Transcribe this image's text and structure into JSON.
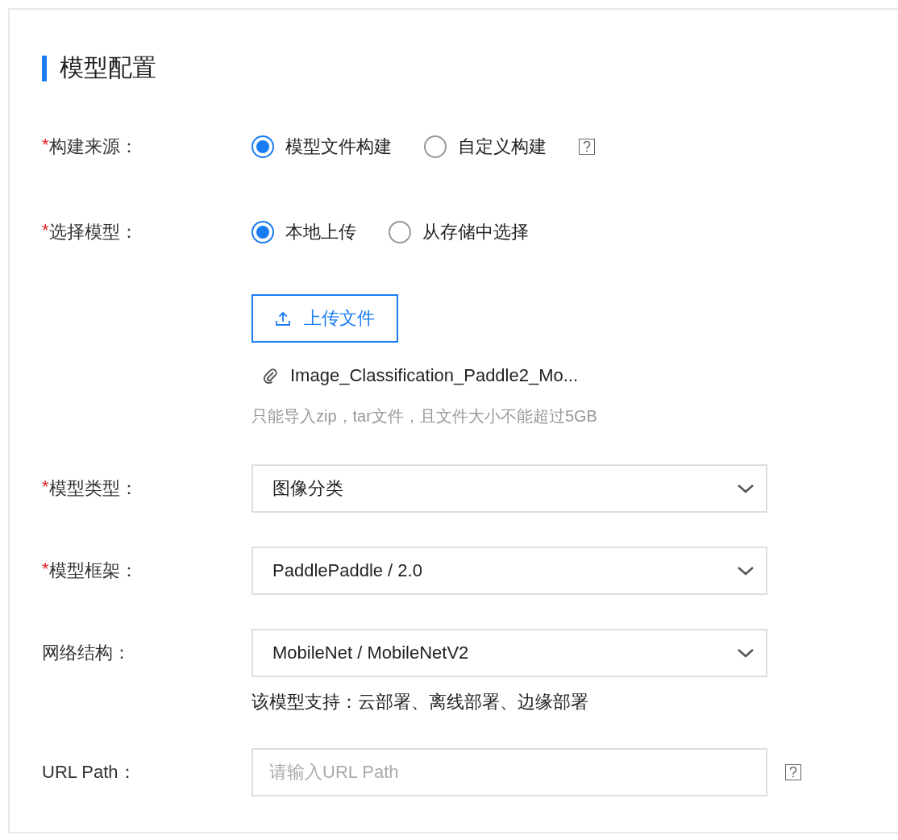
{
  "section": {
    "title": "模型配置"
  },
  "fields": [
    {
      "kind": "radio",
      "mark": "*",
      "label": "构建来源：",
      "help": true,
      "options": [
        {
          "label": "模型文件构建",
          "selected": true
        },
        {
          "label": "自定义构建",
          "selected": false
        }
      ]
    },
    {
      "kind": "radio",
      "mark": "*",
      "label": "选择模型：",
      "options": [
        {
          "label": "本地上传",
          "selected": true
        },
        {
          "label": "从存储中选择",
          "selected": false
        }
      ]
    },
    {
      "kind": "upload",
      "button": "上传文件",
      "file": "Image_Classification_Paddle2_Mo...",
      "hint": "只能导入zip，tar文件，且文件大小不能超过5GB"
    },
    {
      "kind": "select",
      "mark": "*",
      "label": "模型类型：",
      "value": "图像分类"
    },
    {
      "kind": "select",
      "mark": "*",
      "label": "模型框架：",
      "value": "PaddlePaddle / 2.0"
    },
    {
      "kind": "select",
      "label": "网络结构：",
      "value": "MobileNet / MobileNetV2",
      "note": "该模型支持：云部署、离线部署、边缘部署"
    },
    {
      "kind": "input",
      "label": "URL Path：",
      "help": true,
      "placeholder": "请输入URL Path"
    }
  ]
}
